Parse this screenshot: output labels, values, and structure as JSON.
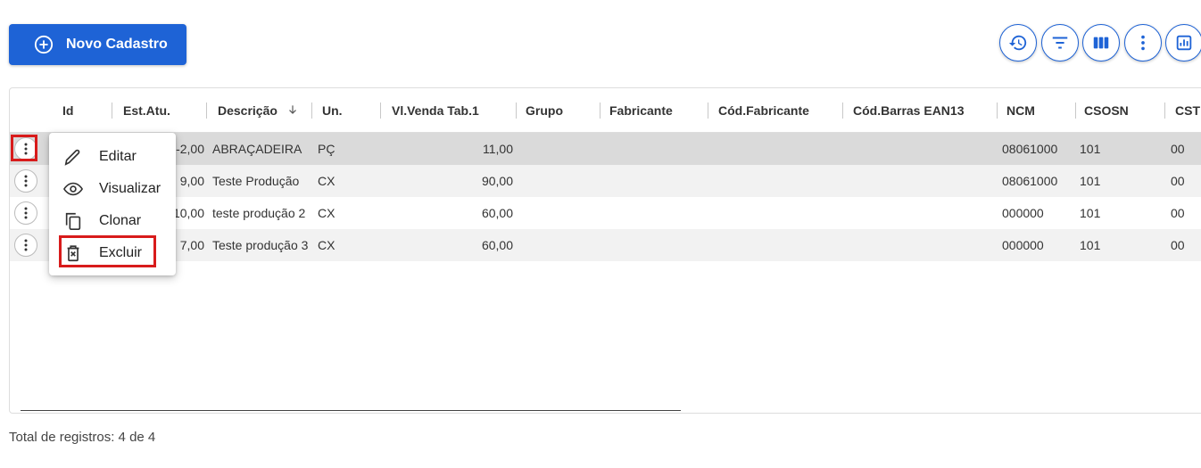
{
  "toolbar": {
    "new_button_label": "Novo Cadastro",
    "icons": [
      "history-icon",
      "filter-icon",
      "columns-icon",
      "more-vert-icon",
      "report-chart-icon"
    ],
    "accent_color": "#1e63d6"
  },
  "table": {
    "columns": [
      "Id",
      "Est.Atu.",
      "Descrição",
      "Un.",
      "Vl.Venda Tab.1",
      "Grupo",
      "Fabricante",
      "Cód.Fabricante",
      "Cód.Barras EAN13",
      "NCM",
      "CSOSN",
      "CST"
    ],
    "sort_column": "Descrição",
    "sort_direction": "descending",
    "rows": [
      {
        "stock": "-2,00",
        "description": "ABRAÇADEIRA",
        "unit": "PÇ",
        "price": "11,00",
        "ncm": "08061000",
        "csosn": "101",
        "cst": "00",
        "selected": true
      },
      {
        "stock": "9,00",
        "description": "Teste Produção",
        "unit": "CX",
        "price": "90,00",
        "ncm": "08061000",
        "csosn": "101",
        "cst": "00"
      },
      {
        "stock": "10,00",
        "description": "teste produção 2",
        "unit": "CX",
        "price": "60,00",
        "ncm": "000000",
        "csosn": "101",
        "cst": "00"
      },
      {
        "stock": "7,00",
        "description": "Teste produção 3",
        "unit": "CX",
        "price": "60,00",
        "ncm": "000000",
        "csosn": "101",
        "cst": "00"
      }
    ]
  },
  "context_menu": {
    "items": [
      {
        "label": "Editar",
        "icon": "edit-pencil-icon"
      },
      {
        "label": "Visualizar",
        "icon": "eye-icon"
      },
      {
        "label": "Clonar",
        "icon": "copy-icon"
      },
      {
        "label": "Excluir",
        "icon": "delete-icon",
        "highlighted": true
      }
    ]
  },
  "footer": {
    "total_text": "Total de registros: 4 de 4"
  },
  "highlight_color": "#d81b1b"
}
